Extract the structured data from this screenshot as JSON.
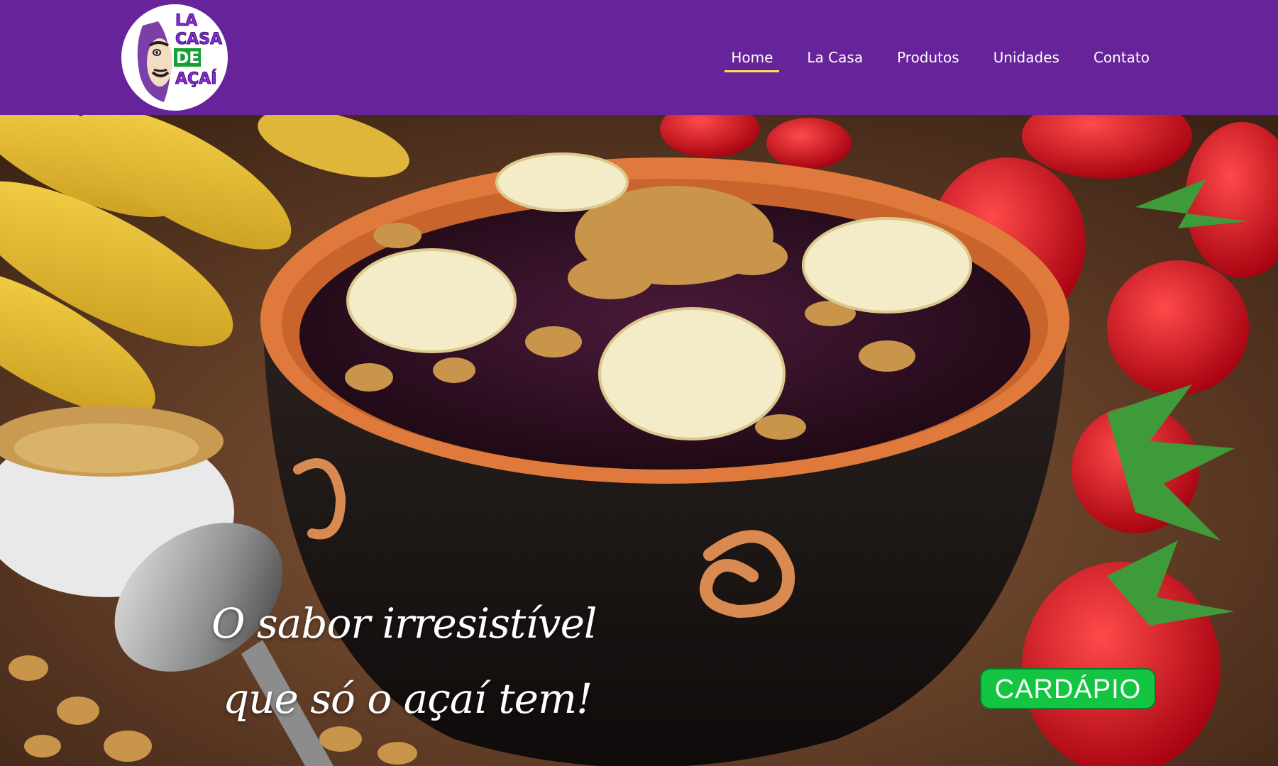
{
  "logo": {
    "lines": [
      "LA",
      "CASA",
      "DE",
      "AÇAÍ"
    ]
  },
  "nav": {
    "items": [
      {
        "label": "Home",
        "active": true
      },
      {
        "label": "La Casa",
        "active": false
      },
      {
        "label": "Produtos",
        "active": false
      },
      {
        "label": "Unidades",
        "active": false
      },
      {
        "label": "Contato",
        "active": false
      }
    ]
  },
  "hero": {
    "tagline_line1": "O sabor irresistível",
    "tagline_line2": "que só o açaí tem!",
    "cta_label": "CARDÁPIO"
  },
  "colors": {
    "header_bg": "#67239a",
    "nav_active_underline": "#ffe14d",
    "cta_bg": "#14c542",
    "logo_purple": "#8a2be2",
    "logo_green": "#14a032"
  }
}
